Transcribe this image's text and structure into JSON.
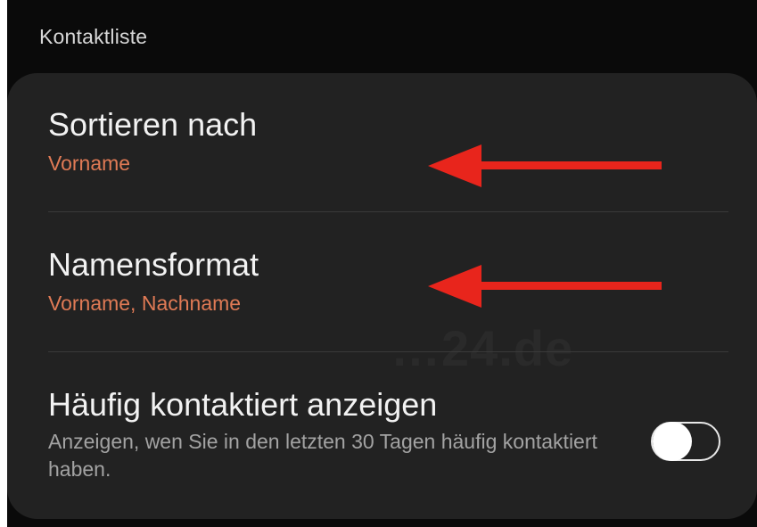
{
  "section": {
    "title": "Kontaktliste"
  },
  "settings": [
    {
      "title": "Sortieren nach",
      "value": "Vorname"
    },
    {
      "title": "Namensformat",
      "value": "Vorname, Nachname"
    },
    {
      "title": "Häufig kontaktiert anzeigen",
      "description": "Anzeigen, wen Sie in den letzten 30 Tagen häufig kontaktiert haben.",
      "toggle_state": "off"
    }
  ],
  "watermark": "…24.de",
  "colors": {
    "background": "#0a0a0a",
    "card": "#222222",
    "accent_value": "#e07a55",
    "annotation_arrow": "#e8251c"
  }
}
